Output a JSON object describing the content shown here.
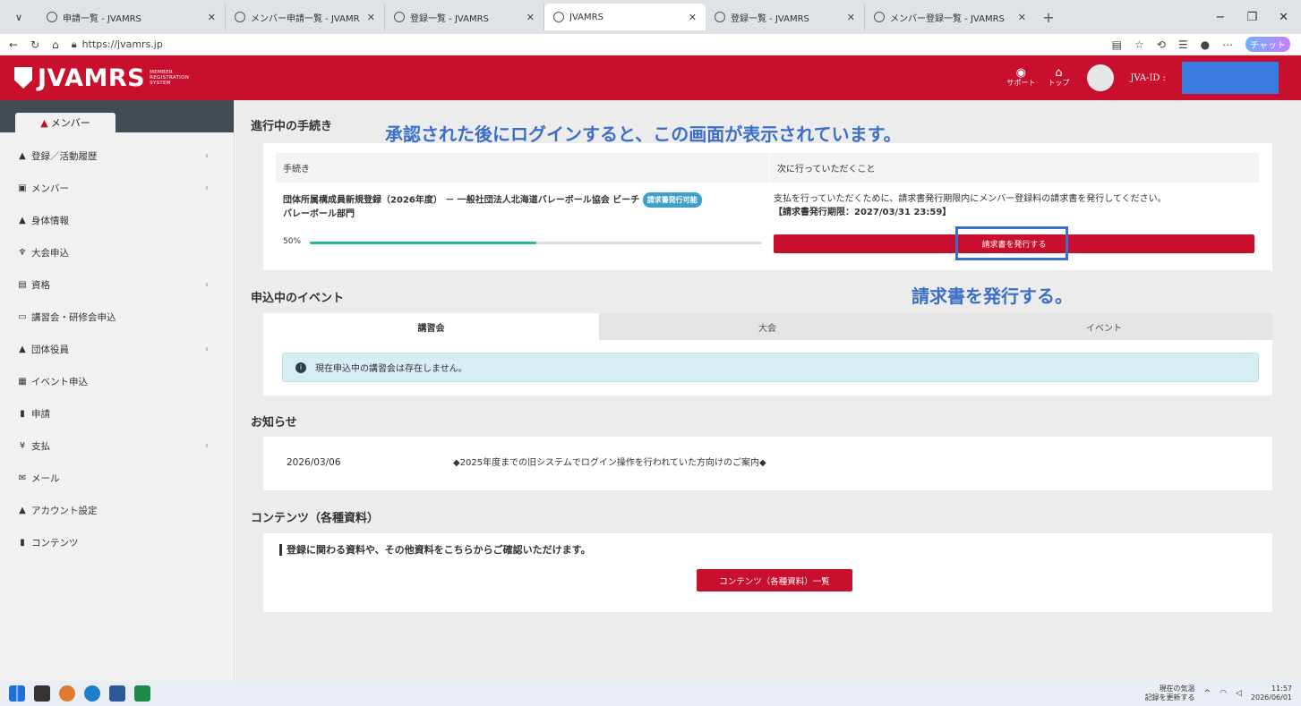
{
  "browser": {
    "tabs": [
      {
        "label": "申請一覧 - JVAMRS"
      },
      {
        "label": "メンバー申請一覧 - JVAMRS"
      },
      {
        "label": "登録一覧 - JVAMRS"
      },
      {
        "label": "JVAMRS"
      },
      {
        "label": "登録一覧 - JVAMRS"
      },
      {
        "label": "メンバー登録一覧 - JVAMRS"
      }
    ],
    "url": "https://jvamrs.jp",
    "chat_label": "チャット"
  },
  "header": {
    "logo_text": "JVAMRS",
    "logo_sub1": "MEMBER",
    "logo_sub2": "REGISTRATION",
    "logo_sub3": "SYSTEM",
    "support_label": "サポート",
    "top_label": "トップ",
    "jva_id_label": "JVA-ID :"
  },
  "sidebar": {
    "active_tab": "メンバー",
    "items": [
      {
        "label": "登録／活動履歴",
        "icon": "person-icon",
        "glyph": "▲",
        "chevron": true
      },
      {
        "label": "メンバー",
        "icon": "id-card-icon",
        "glyph": "▣",
        "chevron": true
      },
      {
        "label": "身体情報",
        "icon": "person-plus-icon",
        "glyph": "▲",
        "chevron": false
      },
      {
        "label": "大会申込",
        "icon": "trophy-icon",
        "glyph": "♆",
        "chevron": false
      },
      {
        "label": "資格",
        "icon": "certificate-icon",
        "glyph": "▤",
        "chevron": true
      },
      {
        "label": "講習会・研修会申込",
        "icon": "presentation-icon",
        "glyph": "▭",
        "chevron": false
      },
      {
        "label": "団体役員",
        "icon": "officer-icon",
        "glyph": "▲",
        "chevron": true
      },
      {
        "label": "イベント申込",
        "icon": "calendar-icon",
        "glyph": "▦",
        "chevron": false
      },
      {
        "label": "申請",
        "icon": "file-icon",
        "glyph": "▮",
        "chevron": false
      },
      {
        "label": "支払",
        "icon": "yen-icon",
        "glyph": "¥",
        "chevron": true
      },
      {
        "label": "メール",
        "icon": "mail-icon",
        "glyph": "✉",
        "chevron": false
      },
      {
        "label": "アカウント設定",
        "icon": "account-settings-icon",
        "glyph": "▲",
        "chevron": false
      },
      {
        "label": "コンテンツ",
        "icon": "document-icon",
        "glyph": "▮",
        "chevron": false
      }
    ]
  },
  "procedures": {
    "title": "進行中の手続き",
    "col1": "手続き",
    "col2": "次に行っていただくこと",
    "row_name_1": "団体所属構成員新規登録（2026年度） － 一般社団法人北海道バレーボール協会 ビーチ",
    "row_name_2": "バレーボール部門",
    "badge": "請求書発行可能",
    "progress_label": "50%",
    "progress": 0.5,
    "next_text": "支払を行っていただくために、請求書発行期限内にメンバー登録料の請求書を発行してください。",
    "deadline": "【請求書発行期限：2027/03/31 23:59】",
    "issue_button": "請求書を発行する"
  },
  "annotations": {
    "top": "承認された後にログインすると、この画面が表示されています。",
    "issue": "請求書を発行する。"
  },
  "events": {
    "title": "申込中のイベント",
    "tabs": [
      "講習会",
      "大会",
      "イベント"
    ],
    "alert": "現在申込中の講習会は存在しません。"
  },
  "news": {
    "title": "お知らせ",
    "date": "2026/03/06",
    "text": "◆2025年度までの旧システムでログイン操作を行われていた方向けのご案内◆"
  },
  "contents": {
    "title": "コンテンツ（各種資料）",
    "desc": "登録に関わる資料や、その他資料をこちらからご確認いただけます。",
    "button": "コンテンツ（各種資料）一覧"
  },
  "taskbar": {
    "weather1": "現在の気温",
    "weather2": "記録を更新する",
    "time": "11:57",
    "date": "2026/06/01"
  },
  "colors": {
    "brand": "#c8102e",
    "annotation": "#3b6fc9",
    "progress": "#2bb5a0"
  }
}
